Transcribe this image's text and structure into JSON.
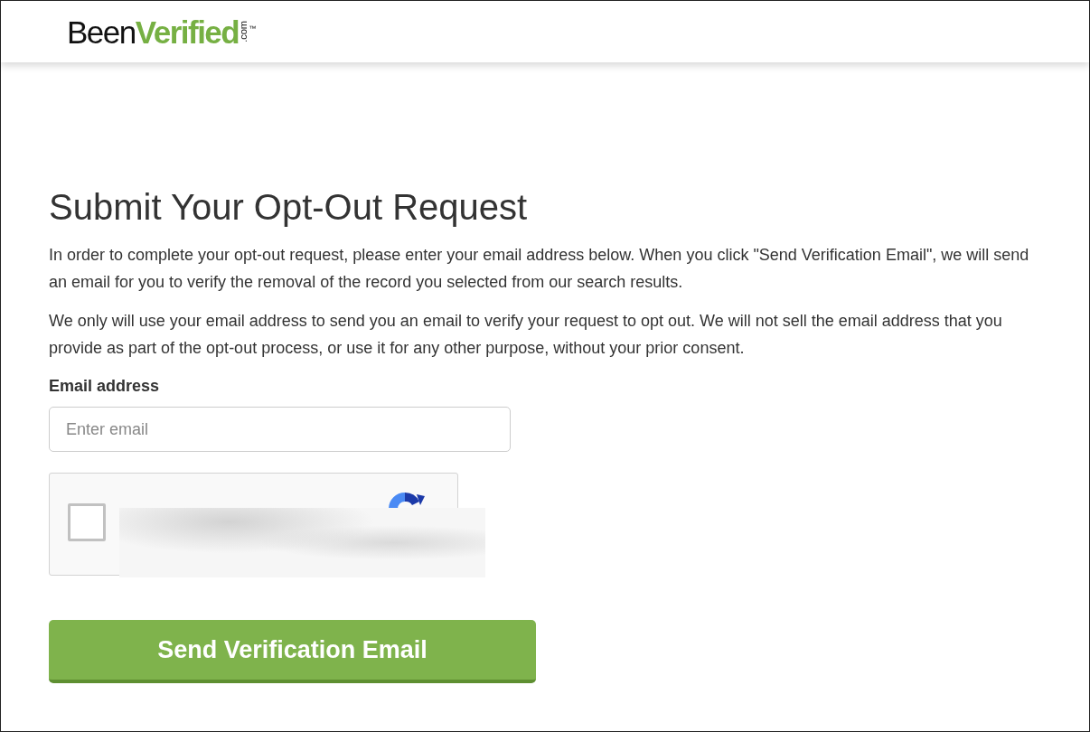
{
  "logo": {
    "part_1": "Been",
    "part_2": "Verified",
    "suffix": ".com",
    "trademark": "™"
  },
  "heading": "Submit Your Opt-Out Request",
  "paragraphs": [
    "In order to complete your opt-out request, please enter your email address below. When you click \"Send Verification Email\", we will send an email for you to verify the removal of the record you selected from our search results.",
    "We only will use your email address to send you an email to verify your request to opt out. We will not sell the email address that you provide as part of the opt-out process, or use it for any other purpose, without your prior consent."
  ],
  "email_field": {
    "label": "Email address",
    "placeholder": "Enter email"
  },
  "captcha": {
    "checked": false
  },
  "submit_button": "Send Verification Email"
}
